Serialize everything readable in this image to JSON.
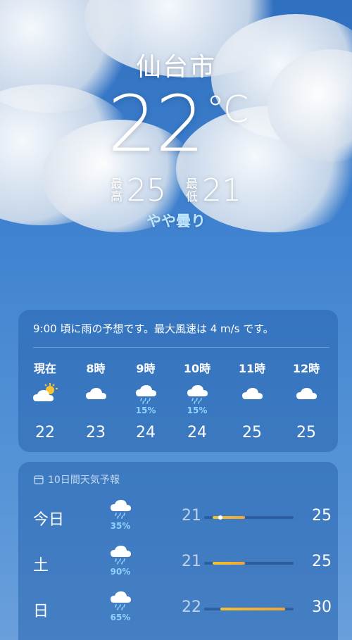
{
  "location": {
    "city": "仙台市"
  },
  "current": {
    "temperature": "22",
    "unit": "°C",
    "high_label": [
      "最",
      "高"
    ],
    "high": "25",
    "low_label": [
      "最",
      "低"
    ],
    "low": "21",
    "condition": "やや曇り"
  },
  "hourly_card": {
    "summary": "9:00 頃に雨の予想です。最大風速は 4 m/s です。",
    "hours": [
      {
        "time": "現在",
        "icon": "partly-sunny-icon",
        "precip": "",
        "temp": "22"
      },
      {
        "time": "8時",
        "icon": "cloud-icon",
        "precip": "",
        "temp": "23"
      },
      {
        "time": "9時",
        "icon": "rain-cloud-icon",
        "precip": "15%",
        "temp": "24"
      },
      {
        "time": "10時",
        "icon": "rain-cloud-icon",
        "precip": "15%",
        "temp": "24"
      },
      {
        "time": "11時",
        "icon": "cloud-icon",
        "precip": "",
        "temp": "25"
      },
      {
        "time": "12時",
        "icon": "cloud-icon",
        "precip": "",
        "temp": "25"
      }
    ]
  },
  "daily_card": {
    "title": "10日間天気予報",
    "scale": {
      "min": 20,
      "max": 31
    },
    "days": [
      {
        "day": "今日",
        "icon": "rain-cloud-icon",
        "precip": "35%",
        "low": "21",
        "high": "25",
        "current": 22
      },
      {
        "day": "土",
        "icon": "rain-cloud-icon",
        "precip": "90%",
        "low": "21",
        "high": "25"
      },
      {
        "day": "日",
        "icon": "rain-cloud-icon",
        "precip": "65%",
        "low": "22",
        "high": "30"
      }
    ]
  }
}
